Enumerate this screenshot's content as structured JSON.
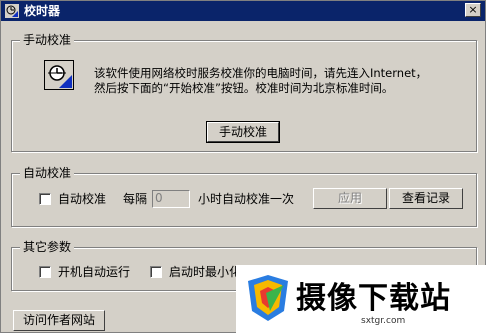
{
  "window": {
    "title": "校时器",
    "close_label": "×"
  },
  "manual_group": {
    "label": "手动校准",
    "description_line1": "该软件使用网络校时服务校准你的电脑时间，请先连入Internet，",
    "description_line2": "然后按下面的“开始校准”按钮。校准时间为北京标准时间。",
    "button_label": "手动校准"
  },
  "auto_group": {
    "label": "自动校准",
    "checkbox_label": "自动校准",
    "interval_prefix": "每隔",
    "interval_value": "0",
    "interval_suffix": "小时自动校准一次",
    "apply_label": "应用",
    "view_log_label": "查看记录"
  },
  "other_group": {
    "label": "其它参数",
    "autostart_label": "开机自动运行",
    "minimize_label": "启动时最小化"
  },
  "footer": {
    "author_site_label": "访问作者网站"
  },
  "watermark": {
    "text": "摄像下载站",
    "url": "sxtgr.com"
  },
  "colors": {
    "titlebar": "#0a246a",
    "face": "#d4d0c8"
  }
}
